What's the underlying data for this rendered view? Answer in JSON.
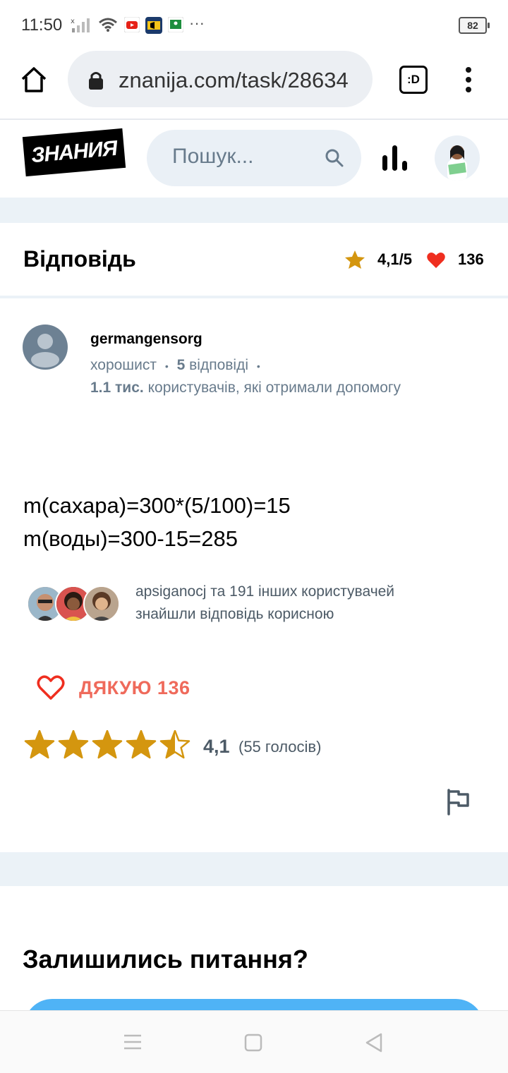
{
  "status_bar": {
    "time": "11:50",
    "more": "···",
    "battery": "82"
  },
  "browser": {
    "url": "znanija.com/task/28634",
    "tabs_label": ":D"
  },
  "site": {
    "logo_text": "ЗНАНИЯ",
    "search_placeholder": "Пошук..."
  },
  "answer_header": {
    "title": "Відповідь",
    "rating": "4,1/5",
    "likes": "136"
  },
  "author": {
    "name": "germangensorg",
    "rank": "хорошист",
    "bullet": "•",
    "answers_count": "5",
    "answers_label": "відповіді",
    "helped_count": "1.1 тис.",
    "helped_label": "користувачів, які отримали допомогу"
  },
  "answer": {
    "lines": [
      "m(сахара)=300*(5/100)=15",
      "m(воды)=300-15=285"
    ]
  },
  "helpers": {
    "line1": "apsiganocj та 191 інших користувачей",
    "line2": "знайшли відповідь корисною"
  },
  "thanks": {
    "label": "ДЯКУЮ 136"
  },
  "rating": {
    "value": 4.1,
    "score_text": "4,1",
    "votes_text": "(55 голосів)"
  },
  "more_questions": {
    "title": "Залишились питання?"
  },
  "colors": {
    "accent_red": "#ef6a5b",
    "star": "#d4960f",
    "band": "#ebf2f7",
    "button_blue": "#4fb3f6"
  }
}
